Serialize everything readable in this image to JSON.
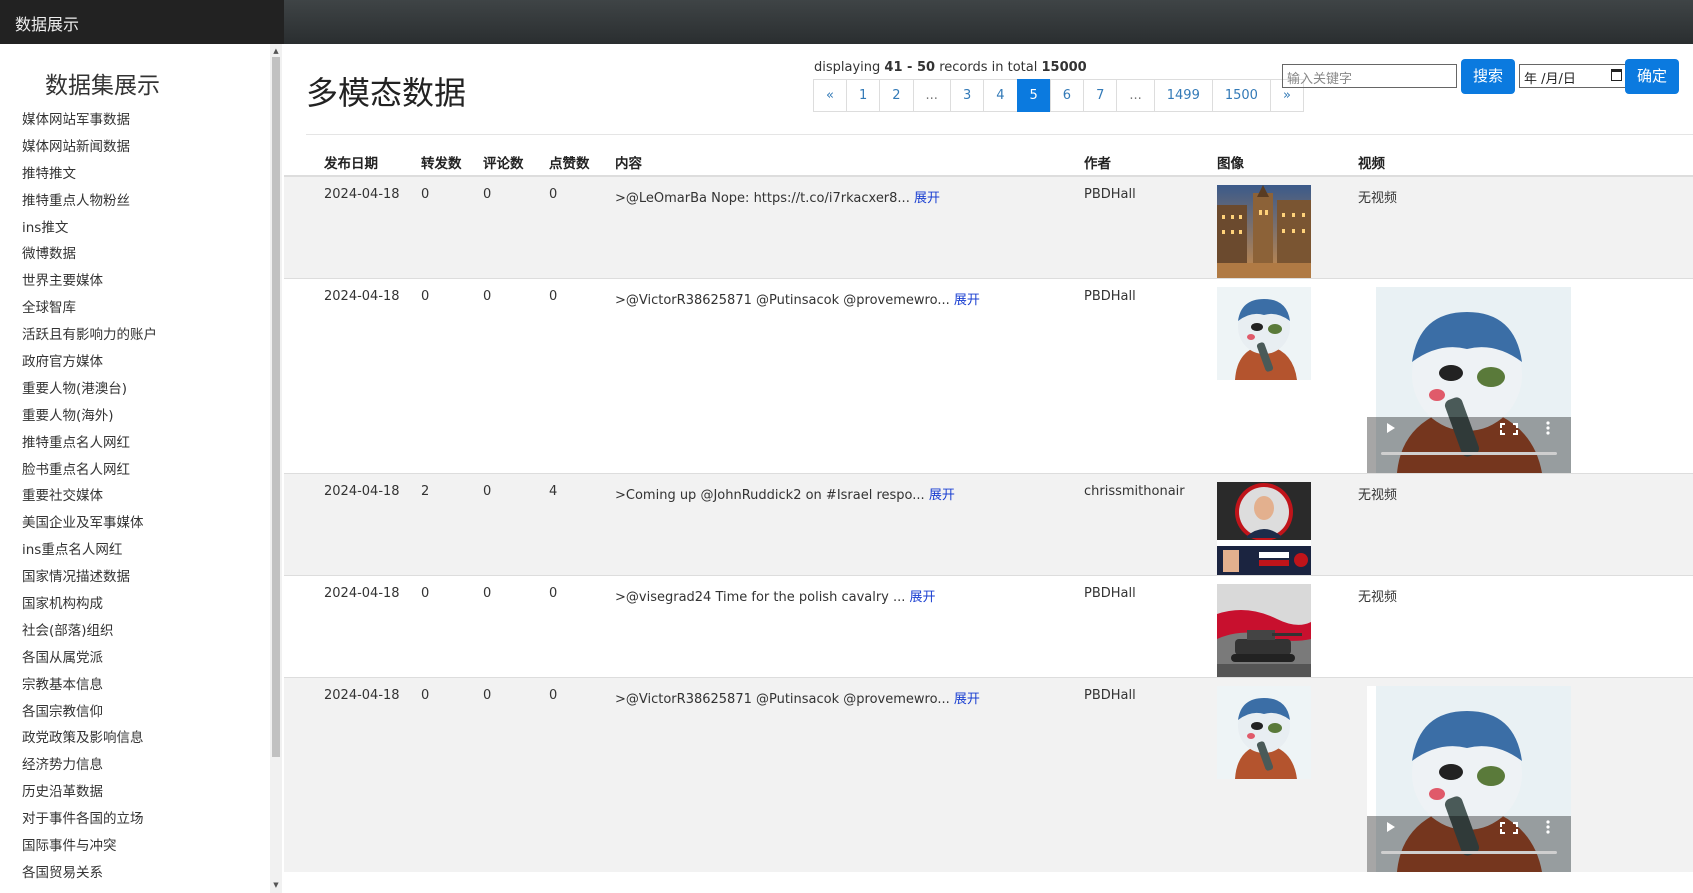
{
  "app": {
    "brand": "数据展示"
  },
  "sidebar": {
    "title": "数据集展示",
    "items": [
      "媒体网站军事数据",
      "媒体网站新闻数据",
      "推特推文",
      "推特重点人物粉丝",
      "ins推文",
      "微博数据",
      "世界主要媒体",
      "全球智库",
      "活跃且有影响力的账户",
      "政府官方媒体",
      "重要人物(港澳台)",
      "重要人物(海外)",
      "推特重点名人网红",
      "脸书重点名人网红",
      "重要社交媒体",
      "美国企业及军事媒体",
      "ins重点名人网红",
      "国家情况描述数据",
      "国家机构构成",
      "社会(部落)组织",
      "各国从属党派",
      "宗教基本信息",
      "各国宗教信仰",
      "政党政策及影响信息",
      "经济势力信息",
      "历史沿革数据",
      "对于事件各国的立场",
      "国际事件与冲突",
      "各国贸易关系"
    ]
  },
  "main": {
    "title": "多模态数据",
    "pagination": {
      "info_prefix": "displaying",
      "range": "41 - 50",
      "info_middle": "records in total",
      "total": "15000",
      "pages": [
        "«",
        "1",
        "2",
        "...",
        "3",
        "4",
        "5",
        "6",
        "7",
        "...",
        "1499",
        "1500",
        "»"
      ],
      "active": "5"
    },
    "search": {
      "placeholder": "输入关键字",
      "button": "搜索"
    },
    "date": {
      "placeholder": "年 /月/日",
      "button": "确定"
    }
  },
  "table": {
    "headers": [
      "发布日期",
      "转发数",
      "评论数",
      "点赞数",
      "内容",
      "作者",
      "图像",
      "视频"
    ],
    "more_label": "展开",
    "no_video": "无视频",
    "rows": [
      {
        "date": "2024-04-18",
        "reposts": "0",
        "comments": "0",
        "likes": "0",
        "content": ">@LeOmarBa Nope: https://t.co/i7rkacxer8...",
        "author": "PBDHall",
        "image": "city-square",
        "video": ""
      },
      {
        "date": "2024-04-18",
        "reposts": "0",
        "comments": "0",
        "likes": "0",
        "content": ">@VictorR38625871 @Putinsacok @provemewro...",
        "author": "PBDHall",
        "image": "penguin-cartoon",
        "video": "penguin-cartoon"
      },
      {
        "date": "2024-04-18",
        "reposts": "2",
        "comments": "0",
        "likes": "4",
        "content": ">Coming up @JohnRuddick2 on #Israel respo...",
        "author": "chrissmithonair",
        "image": "show-promo",
        "video": ""
      },
      {
        "date": "2024-04-18",
        "reposts": "0",
        "comments": "0",
        "likes": "0",
        "content": ">@visegrad24 Time for the polish cavalry ...",
        "author": "PBDHall",
        "image": "tank-flag",
        "video": ""
      },
      {
        "date": "2024-04-18",
        "reposts": "0",
        "comments": "0",
        "likes": "0",
        "content": ">@VictorR38625871 @Putinsacok @provemewro...",
        "author": "PBDHall",
        "image": "penguin-cartoon",
        "video": "penguin-cartoon"
      }
    ]
  }
}
